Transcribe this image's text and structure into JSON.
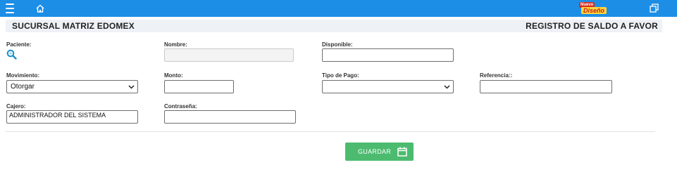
{
  "header": {
    "menu_icon": "hamburger-icon",
    "home_icon": "home-icon",
    "logo": {
      "line1": "Nuevo",
      "line2": "Diseño"
    },
    "restore_icon": "window-restore-icon",
    "bar_color": "#1d8ee6"
  },
  "title": {
    "branch": "SUCURSAL MATRIZ EDOMEX",
    "section": "REGISTRO DE SALDO A FAVOR"
  },
  "form": {
    "paciente": {
      "label": "Paciente:",
      "icon": "search-icon"
    },
    "nombre": {
      "label": "Nombre:",
      "value": ""
    },
    "disponible": {
      "label": "Disponible:",
      "value": ""
    },
    "movimiento": {
      "label": "Movimiento:",
      "value": "Otorgar"
    },
    "monto": {
      "label": "Monto:",
      "value": ""
    },
    "tipo_pago": {
      "label": "Tipo de Pago:",
      "value": ""
    },
    "referencia": {
      "label": "Referencia::",
      "value": ""
    },
    "cajero": {
      "label": "Cajero:",
      "value": "ADMINISTRADOR DEL SISTEMA"
    },
    "contrasena": {
      "label": "Contraseña:",
      "value": ""
    }
  },
  "actions": {
    "save_label": "GUARDAR",
    "save_icon": "calendar-icon",
    "save_color": "#4cbb6f"
  }
}
